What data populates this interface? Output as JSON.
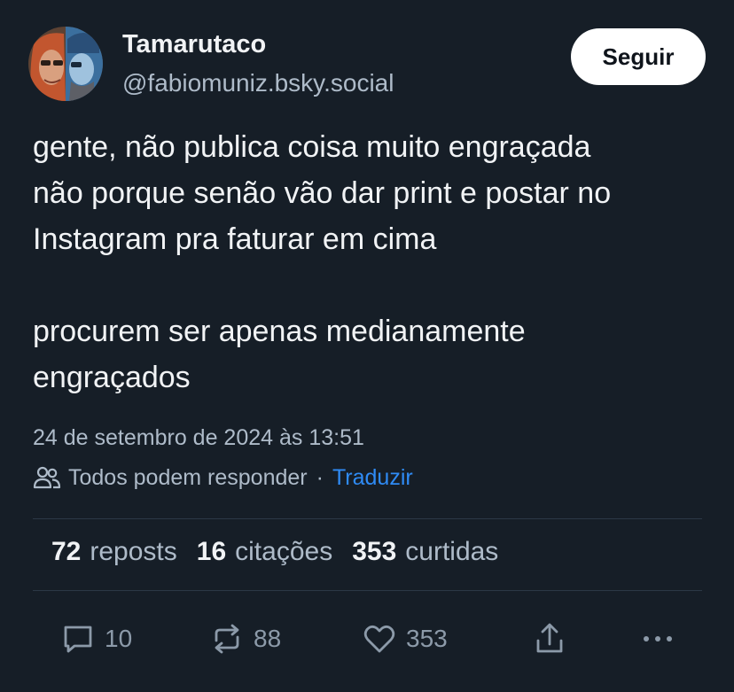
{
  "author": {
    "name": "Tamarutaco",
    "handle": "@fabiomuniz.bsky.social",
    "avatar_icon": "avatar-photo"
  },
  "follow_button": {
    "label": "Seguir"
  },
  "post": {
    "paragraphs": [
      [
        "gente, não publica coisa muito engraçada",
        "não porque senão vão dar print e postar no",
        "Instagram pra faturar em cima"
      ],
      [
        "procurem ser apenas medianamente",
        "engraçados"
      ]
    ],
    "timestamp": "24 de setembro de 2024 às 13:51",
    "reply_setting": "Todos podem responder",
    "separator": "·",
    "translate_label": "Traduzir"
  },
  "stats": [
    {
      "count": "72",
      "label": "reposts"
    },
    {
      "count": "16",
      "label": "citações"
    },
    {
      "count": "353",
      "label": "curtidas"
    }
  ],
  "actions": {
    "reply": {
      "icon": "reply-icon",
      "count": "10"
    },
    "repost": {
      "icon": "repost-icon",
      "count": "88"
    },
    "like": {
      "icon": "heart-icon",
      "count": "353"
    },
    "share": {
      "icon": "share-icon"
    },
    "more": {
      "icon": "more-icon"
    }
  },
  "colors": {
    "background": "#161e27",
    "text": "#f1f3f5",
    "muted": "#aebbc9",
    "link": "#2f8bf5",
    "divider": "#2c3846"
  }
}
